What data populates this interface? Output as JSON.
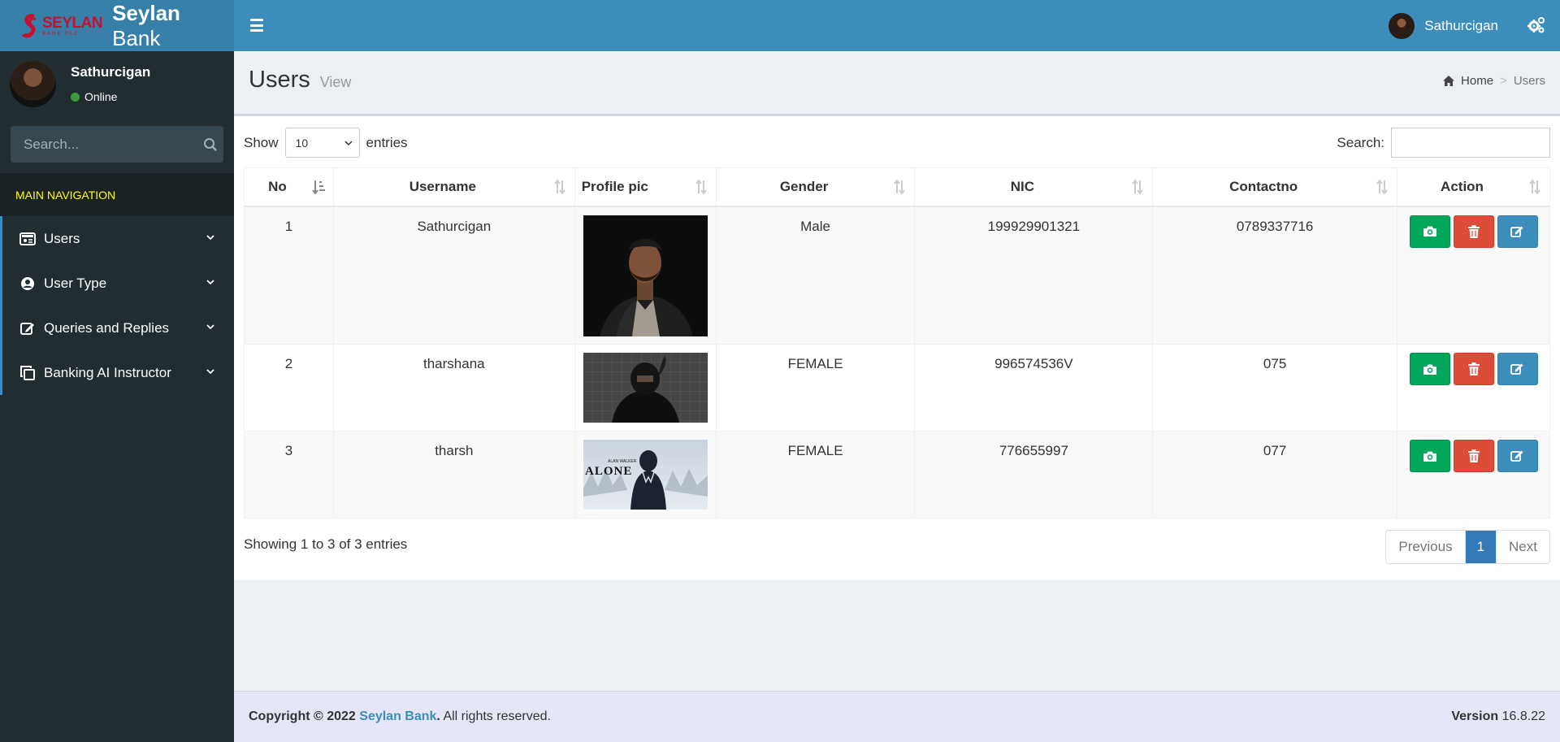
{
  "header": {
    "logo_word": "SEYLAN",
    "logo_sub": "BANK PLC",
    "app_title_bold": "Seylan",
    "app_title_rest": " Bank",
    "user_name": "Sathurcigan"
  },
  "sidebar": {
    "user_name": "Sathurcigan",
    "status": "Online",
    "search_placeholder": "Search...",
    "nav_header": "MAIN NAVIGATION",
    "items": [
      {
        "label": "Users",
        "icon": "id-card-icon"
      },
      {
        "label": "User Type",
        "icon": "user-circle-icon"
      },
      {
        "label": "Queries and Replies",
        "icon": "edit-icon"
      },
      {
        "label": "Banking AI Instructor",
        "icon": "copy-icon"
      }
    ]
  },
  "page": {
    "title": "Users",
    "subtitle": "View",
    "breadcrumb": {
      "home": "Home",
      "current": "Users",
      "separator": ">"
    }
  },
  "table_controls": {
    "show_label": "Show",
    "length_value": "10",
    "entries_label": "entries",
    "search_label": "Search:"
  },
  "table": {
    "columns": [
      "No",
      "Username",
      "Profile pic",
      "Gender",
      "NIC",
      "Contactno",
      "Action"
    ],
    "rows": [
      {
        "no": "1",
        "username": "Sathurcigan",
        "pic": "portrait-dark-jacket",
        "gender": "Male",
        "nic": "199929901321",
        "contact": "0789337716"
      },
      {
        "no": "2",
        "username": "tharshana",
        "pic": "hooded-figure",
        "gender": "FEMALE",
        "nic": "996574536V",
        "contact": "075"
      },
      {
        "no": "3",
        "username": "tharsh",
        "pic": "alone-poster",
        "gender": "FEMALE",
        "nic": "776655997",
        "contact": "077"
      }
    ],
    "pic3_text_small": "ALAN WALKER",
    "pic3_text_big": "ALONE",
    "info": "Showing 1 to 3 of 3 entries",
    "pagination": {
      "previous": "Previous",
      "current": "1",
      "next": "Next"
    }
  },
  "footer": {
    "copyright_prefix": "Copyright © 2022 ",
    "brand": "Seylan Bank",
    "suffix": ". All rights reserved.",
    "version_label": "Version",
    "version_value": " 16.8.22"
  },
  "colors": {
    "header": "#3c8dbc",
    "logo_bg": "#367fa9",
    "sidebar": "#222d32",
    "nav_header_text": "#ffff00",
    "green": "#00a65a",
    "red": "#dd4b39",
    "blue": "#3c8dbc"
  }
}
